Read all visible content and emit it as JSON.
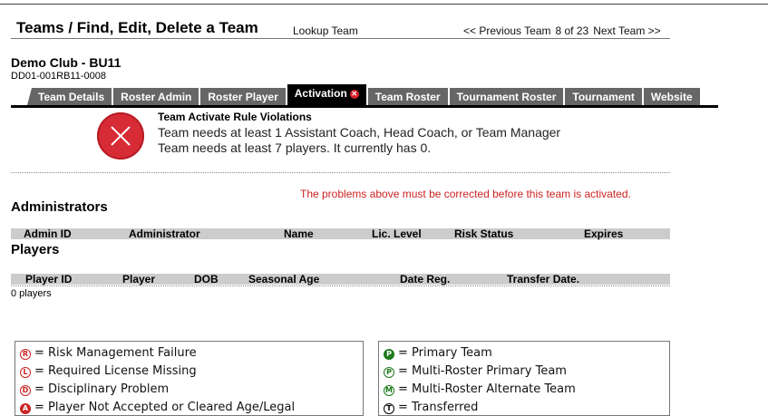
{
  "header": {
    "title": "Teams / Find, Edit, Delete a Team",
    "lookup": "Lookup Team",
    "prev": "<< Previous Team",
    "position": "8 of 23",
    "next": "Next Team >>"
  },
  "team": {
    "name": "Demo Club - BU11",
    "code": "DD01-001RB11-0008"
  },
  "tabs": [
    {
      "label": "Team Details"
    },
    {
      "label": "Roster Admin"
    },
    {
      "label": "Roster Player"
    },
    {
      "label": "Activation",
      "active": true,
      "error_glyph": "✕"
    },
    {
      "label": "Team Roster"
    },
    {
      "label": "Tournament Roster"
    },
    {
      "label": "Tournament"
    },
    {
      "label": "Website"
    }
  ],
  "violations": {
    "title": "Team Activate Rule Violations",
    "lines": [
      "Team needs at least 1 Assistant Coach, Head Coach, or Team Manager",
      "Team needs at least 7 players. It currently has 0."
    ],
    "problems_note": "The problems above must be corrected before this team is activated."
  },
  "administrators": {
    "heading": "Administrators",
    "columns": [
      "Admin ID",
      "Administrator",
      "Name",
      "Lic. Level",
      "Risk Status",
      "Expires"
    ]
  },
  "players": {
    "heading": "Players",
    "columns": [
      "Player ID",
      "Player",
      "DOB",
      "Seasonal Age",
      "Date Reg.",
      "Transfer Date."
    ],
    "count_text": "0 players"
  },
  "legend_left": [
    {
      "glyph": "R",
      "style": "red",
      "text": "= Risk Management Failure"
    },
    {
      "glyph": "L",
      "style": "red",
      "text": "= Required License Missing"
    },
    {
      "glyph": "D",
      "style": "red",
      "text": "= Disciplinary Problem"
    },
    {
      "glyph": "A",
      "style": "redfill",
      "text": "= Player Not Accepted or Cleared Age/Legal"
    }
  ],
  "legend_right": [
    {
      "glyph": "P",
      "style": "greenfill",
      "text": "= Primary Team"
    },
    {
      "glyph": "P",
      "style": "green",
      "text": "= Multi-Roster Primary Team"
    },
    {
      "glyph": "M",
      "style": "green",
      "text": "= Multi-Roster Alternate Team"
    },
    {
      "glyph": "T",
      "style": "black",
      "text": "= Transferred"
    }
  ],
  "colors": {
    "tab_bg": "#666666",
    "tab_active_bg": "#000000",
    "error_red": "#cc2222",
    "violation_icon": "#d72b35",
    "legend_green": "#1d7a1d"
  }
}
